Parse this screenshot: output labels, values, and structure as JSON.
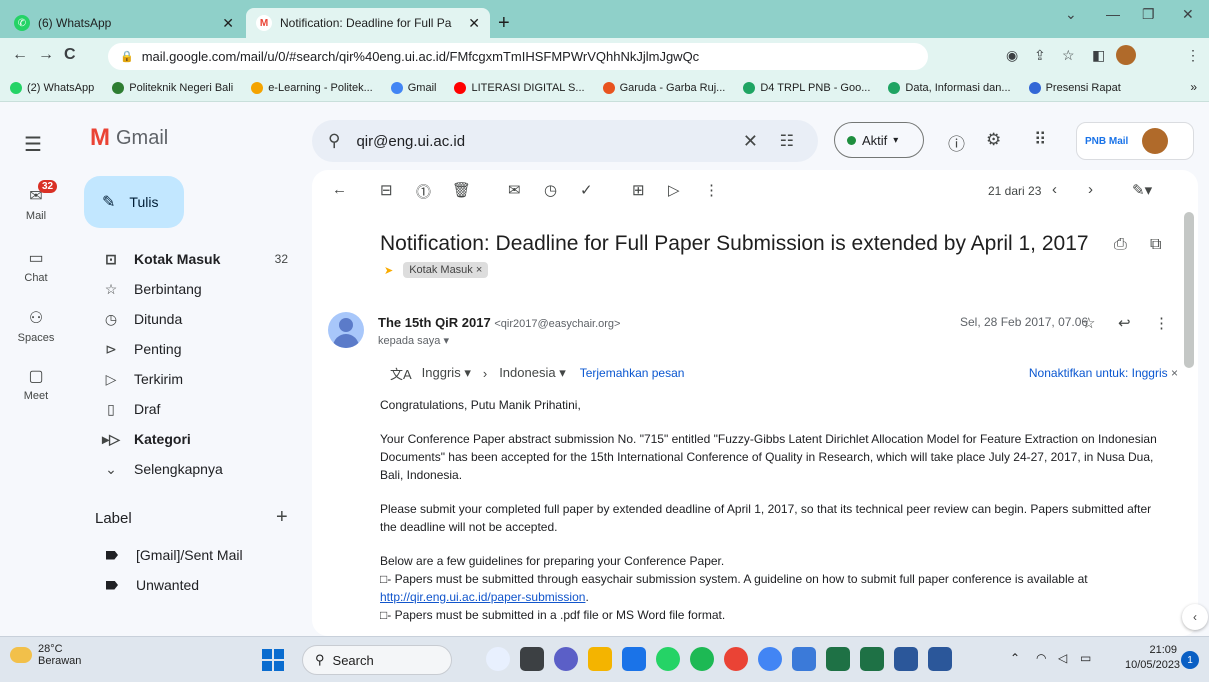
{
  "browser": {
    "tabs": [
      {
        "title": "(6) WhatsApp",
        "icon": "whatsapp-icon",
        "color": "#25d366"
      },
      {
        "title": "Notification: Deadline for Full Pa",
        "icon": "gmail-icon",
        "color": "#ea4335"
      }
    ],
    "url": "mail.google.com/mail/u/0/#search/qir%40eng.ui.ac.id/FMfcgxmTmIHSFMPWrVQhhNkJjlmJgwQc",
    "bookmarks": [
      {
        "label": "(2) WhatsApp",
        "color": "#25d366"
      },
      {
        "label": "Politeknik Negeri Bali",
        "color": "#2e7d32"
      },
      {
        "label": "e-Learning - Politek...",
        "color": "#f4a300"
      },
      {
        "label": "Gmail",
        "color": "#4285f4"
      },
      {
        "label": "LITERASI DIGITAL S...",
        "color": "#ff0000"
      },
      {
        "label": "Garuda - Garba Ruj...",
        "color": "#e8531f"
      },
      {
        "label": "D4 TRPL PNB - Goo...",
        "color": "#1fa463"
      },
      {
        "label": "Data, Informasi dan...",
        "color": "#1fa463"
      },
      {
        "label": "Presensi Rapat",
        "color": "#3367d6"
      }
    ]
  },
  "gmail": {
    "brand": "Gmail",
    "rail": [
      {
        "label": "Mail",
        "badge": "32"
      },
      {
        "label": "Chat"
      },
      {
        "label": "Spaces"
      },
      {
        "label": "Meet"
      }
    ],
    "compose": "Tulis",
    "nav": [
      {
        "label": "Kotak Masuk",
        "count": "32",
        "bold": true,
        "icon": "inbox-icon"
      },
      {
        "label": "Berbintang",
        "icon": "star-icon"
      },
      {
        "label": "Ditunda",
        "icon": "clock-icon"
      },
      {
        "label": "Penting",
        "icon": "important-icon"
      },
      {
        "label": "Terkirim",
        "icon": "send-icon"
      },
      {
        "label": "Draf",
        "icon": "draft-icon"
      },
      {
        "label": "Kategori",
        "bold": true,
        "icon": "category-icon"
      },
      {
        "label": "Selengkapnya",
        "icon": "chevron-down-icon"
      }
    ],
    "label_heading": "Label",
    "labels": [
      "[Gmail]/Sent Mail",
      "Unwanted"
    ],
    "search_value": "qir@eng.ui.ac.id",
    "status": "Aktif",
    "account_name": "PNB Mail",
    "pager": "21 dari 23",
    "subject": "Notification: Deadline for Full Paper Submission is extended by April 1, 2017",
    "inbox_chip": "Kotak Masuk",
    "sender_name": "The 15th QiR 2017",
    "sender_email": "<qir2017@easychair.org>",
    "to": "kepada saya",
    "date": "Sel, 28 Feb 2017, 07.06",
    "translate": {
      "from": "Inggris",
      "to": "Indonesia",
      "link": "Terjemahkan pesan",
      "off": "Nonaktifkan untuk: Inggris"
    },
    "body": {
      "greeting": "Congratulations, Putu Manik Prihatini,",
      "p1": "Your Conference Paper abstract submission No. \"715\" entitled \"Fuzzy-Gibbs Latent Dirichlet Allocation Model for Feature Extraction on Indonesian Documents\" has been accepted for the 15th International Conference of Quality in Research, which will take place July 24-27, 2017, in Nusa Dua, Bali, Indonesia.",
      "p2": "Please submit your completed full paper by extended deadline of April 1, 2017, so that its technical peer review can begin. Papers submitted after the deadline will not be accepted.",
      "p3": "Below are a few guidelines for preparing your Conference Paper.",
      "b1": "- Papers must be submitted through easychair submission system. A guideline on how to submit full paper conference is available at",
      "b1_link": "http://qir.eng.ui.ac.id/paper-submission",
      "b2": "- Papers must be submitted in a .pdf file or MS Word file format."
    }
  },
  "taskbar": {
    "temperature": "28°C",
    "weather": "Berawan",
    "search": "Search",
    "time": "21:09",
    "date": "10/05/2023",
    "notifications": "1"
  }
}
